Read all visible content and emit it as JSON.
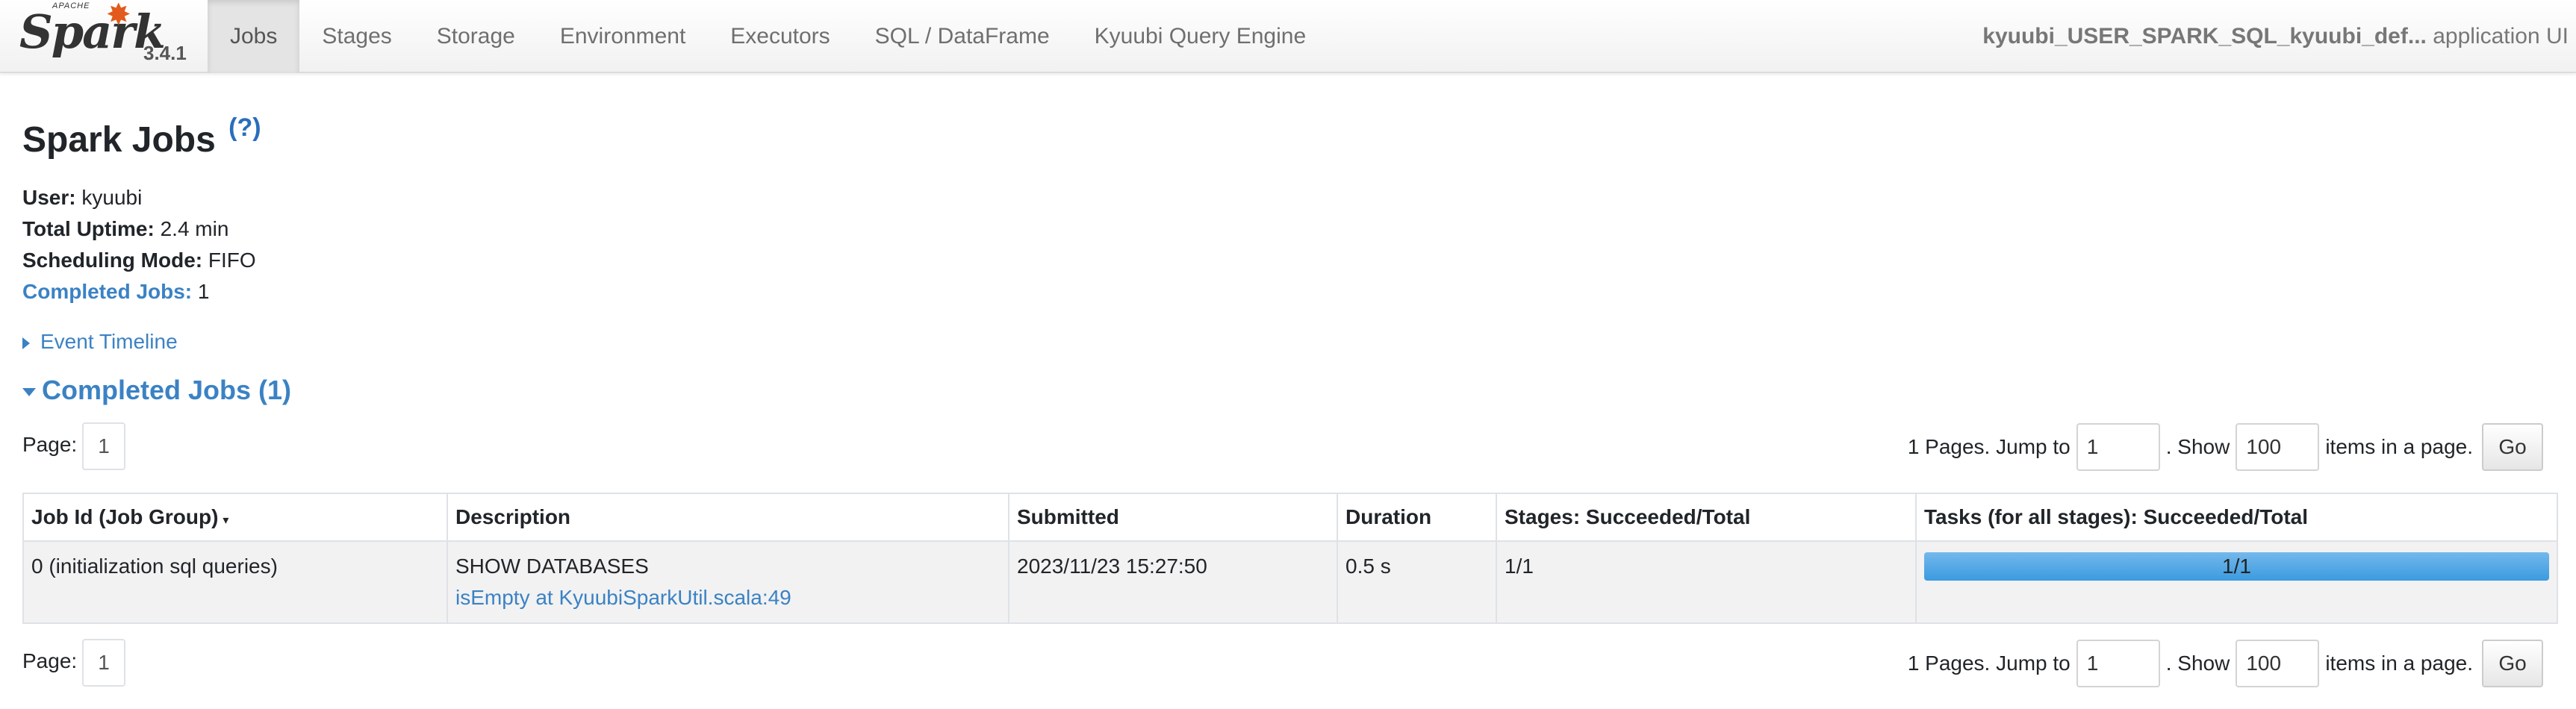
{
  "brand": {
    "apache": "APACHE",
    "logo": "Spark",
    "version": "3.4.1"
  },
  "nav": {
    "items": [
      {
        "label": "Jobs",
        "active": true
      },
      {
        "label": "Stages",
        "active": false
      },
      {
        "label": "Storage",
        "active": false
      },
      {
        "label": "Environment",
        "active": false
      },
      {
        "label": "Executors",
        "active": false
      },
      {
        "label": "SQL / DataFrame",
        "active": false
      },
      {
        "label": "Kyuubi Query Engine",
        "active": false
      }
    ],
    "app_name": "kyuubi_USER_SPARK_SQL_kyuubi_def...",
    "app_suffix": "application UI"
  },
  "page": {
    "title": "Spark Jobs",
    "help": "(?)"
  },
  "summary": {
    "user_label": "User:",
    "user_value": "kyuubi",
    "uptime_label": "Total Uptime:",
    "uptime_value": "2.4 min",
    "mode_label": "Scheduling Mode:",
    "mode_value": "FIFO",
    "completed_label": "Completed Jobs:",
    "completed_value": "1"
  },
  "event_timeline": "Event Timeline",
  "completed_section": "Completed Jobs (1)",
  "pager": {
    "page_label": "Page:",
    "page": "1",
    "pages_text": "1 Pages. Jump to",
    "jump_value": "1",
    "show_text": ". Show",
    "show_value": "100",
    "items_text": "items in a page.",
    "go": "Go"
  },
  "table": {
    "headers": {
      "job_id": "Job Id (Job Group)",
      "sort": "▾",
      "description": "Description",
      "submitted": "Submitted",
      "duration": "Duration",
      "stages": "Stages: Succeeded/Total",
      "tasks": "Tasks (for all stages): Succeeded/Total"
    },
    "rows": [
      {
        "job_id": "0 (initialization sql queries)",
        "description": "SHOW DATABASES",
        "description_link": "isEmpty at KyuubiSparkUtil.scala:49",
        "submitted": "2023/11/23 15:27:50",
        "duration": "0.5 s",
        "stages": "1/1",
        "tasks_text": "1/1",
        "tasks_progress": 1.0
      }
    ]
  },
  "colors": {
    "accent": "#3b82c4",
    "progress": "#5aa9e6"
  }
}
